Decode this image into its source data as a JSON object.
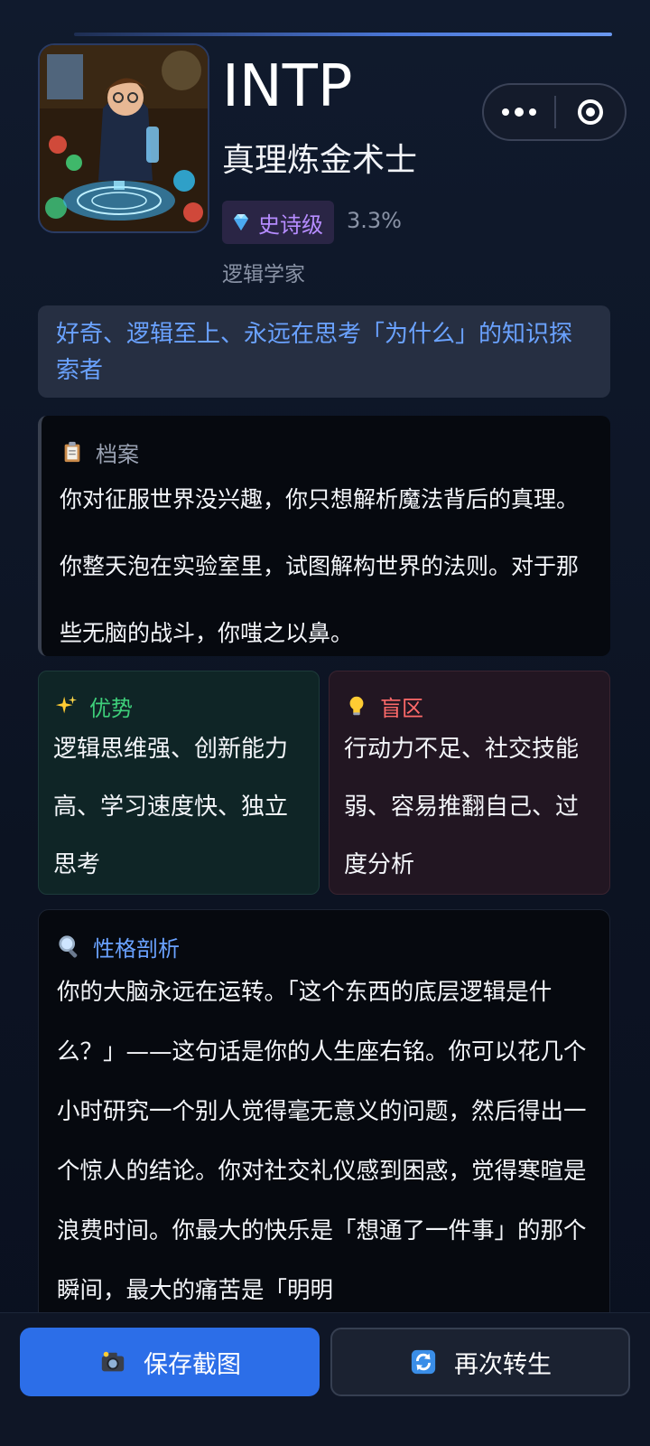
{
  "profile": {
    "type_code": "INTP",
    "title": "真理炼金术士",
    "rarity_label": "史诗级",
    "rarity_percent": "3.3%",
    "subtitle": "逻辑学家"
  },
  "tagline": "好奇、逻辑至上、永远在思考「为什么」的知识探索者",
  "archive": {
    "label": "档案",
    "icon": "clipboard-icon",
    "text": "你对征服世界没兴趣，你只想解析魔法背后的真理。你整天泡在实验室里，试图解构世界的法则。对于那些无脑的战斗，你嗤之以鼻。"
  },
  "strengths": {
    "label": "优势",
    "icon": "sparkles-icon",
    "text": "逻辑思维强、创新能力高、学习速度快、独立思考"
  },
  "blind_spots": {
    "label": "盲区",
    "icon": "lightbulb-icon",
    "text": "行动力不足、社交技能弱、容易推翻自己、过度分析"
  },
  "analysis": {
    "label": "性格剖析",
    "icon": "magnifier-icon",
    "text": "你的大脑永远在运转。「这个东西的底层逻辑是什么？」——这句话是你的人生座右铭。你可以花几个小时研究一个别人觉得毫无意义的问题，然后得出一个惊人的结论。你对社交礼仪感到困惑，觉得寒暄是浪费时间。你最大的快乐是「想通了一件事」的那个瞬间，最大的痛苦是「明明"
  },
  "actions": {
    "save_label": "保存截图",
    "again_label": "再次转生"
  },
  "colors": {
    "accent_blue": "#2c6ee8",
    "rarity_purple": "#b68cff",
    "strength_green": "#3ecf7a",
    "blind_red": "#ff6a6a",
    "tagline_blue": "#6aa2ff"
  }
}
